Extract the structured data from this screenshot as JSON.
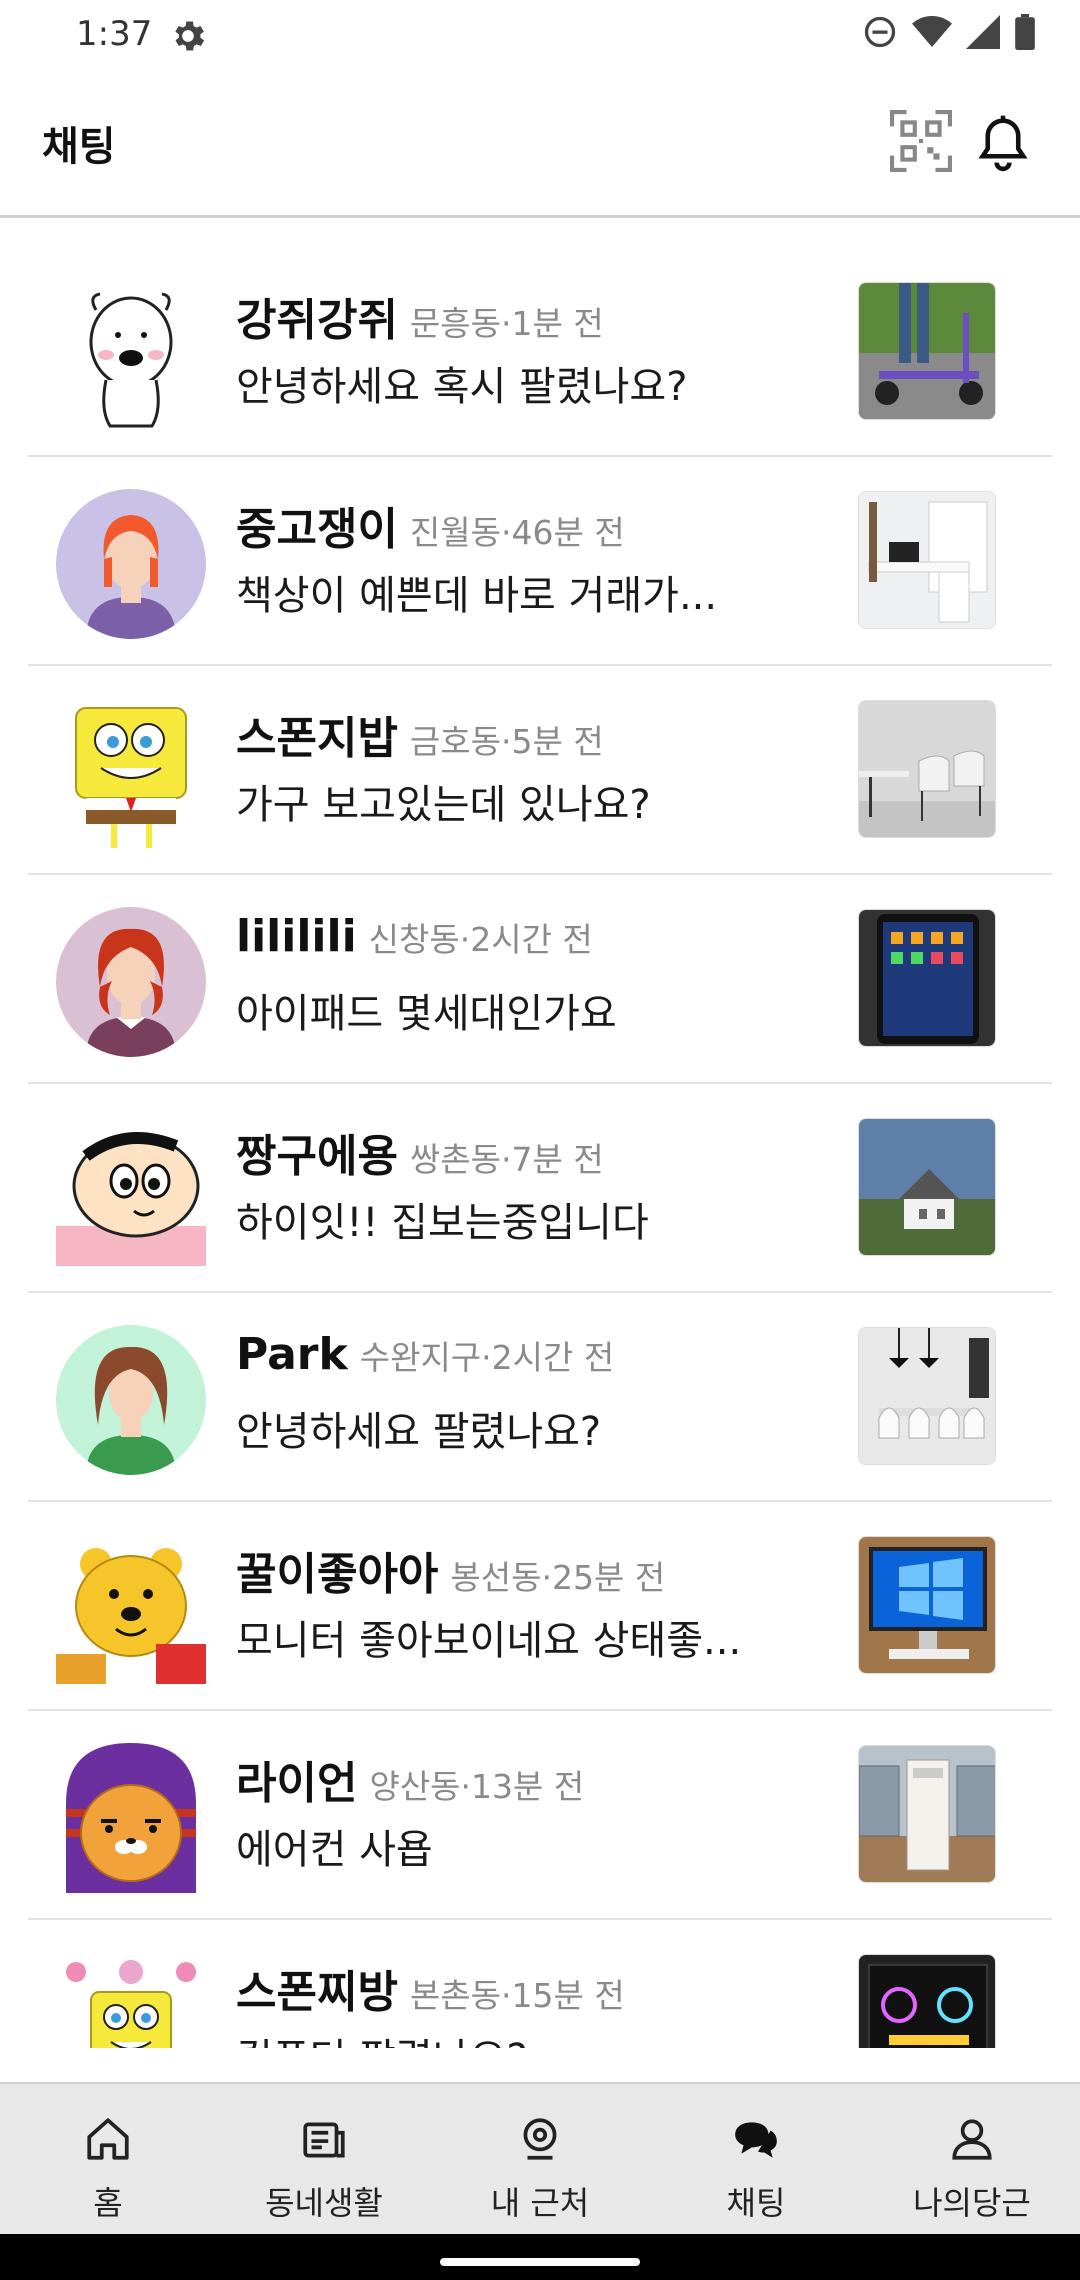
{
  "status": {
    "time": "1:37"
  },
  "app": {
    "title": "채팅"
  },
  "chats": [
    {
      "name": "강쥐강쥐",
      "meta": "문흥동·1분 전",
      "message": "안녕하세요 혹시 팔렸나요?",
      "avatar": "dog-avatar",
      "thumb": "scooter"
    },
    {
      "name": "중고쟁이",
      "meta": "진월동·46분 전",
      "message": "책상이 예쁜데 바로 거래가...",
      "avatar": "person-avatar",
      "thumb": "desk"
    },
    {
      "name": "스폰지밥",
      "meta": "금호동·5분 전",
      "message": "가구 보고있는데 있나요?",
      "avatar": "spongebob-avatar",
      "thumb": "chairs"
    },
    {
      "name": "lililili",
      "meta": "신창동·2시간 전",
      "message": "아이패드 몇세대인가요",
      "avatar": "redhair-avatar",
      "thumb": "ipad"
    },
    {
      "name": "짱구에용",
      "meta": "쌍촌동·7분 전",
      "message": "하이잇!! 집보는중입니다",
      "avatar": "shinchan-avatar",
      "thumb": "house"
    },
    {
      "name": "Park",
      "meta": "수완지구·2시간 전",
      "message": "안녕하세요 팔렸나요?",
      "avatar": "curly-avatar",
      "thumb": "dining"
    },
    {
      "name": "꿀이좋아아",
      "meta": "봉선동·25분 전",
      "message": "모니터 좋아보이네요 상태좋...",
      "avatar": "pooh-avatar",
      "thumb": "monitor"
    },
    {
      "name": "라이언",
      "meta": "양산동·13분 전",
      "message": "에어컨 사욥",
      "avatar": "ryan-avatar",
      "thumb": "aircon"
    },
    {
      "name": "스폰찌방",
      "meta": "본촌동·15분 전",
      "message": "컴퓨터 팔렸나요?",
      "avatar": "spongebob2-avatar",
      "thumb": "pc"
    }
  ],
  "nav": [
    {
      "label": "홈",
      "icon": "home-icon"
    },
    {
      "label": "동네생활",
      "icon": "news-icon"
    },
    {
      "label": "내 근처",
      "icon": "location-icon"
    },
    {
      "label": "채팅",
      "icon": "chat-icon"
    },
    {
      "label": "나의당근",
      "icon": "person-icon"
    }
  ]
}
